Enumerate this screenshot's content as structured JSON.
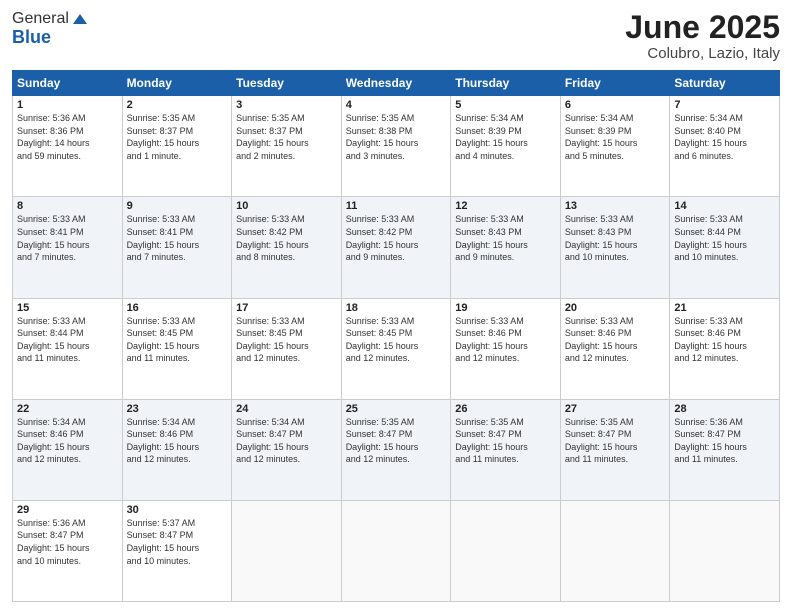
{
  "header": {
    "logo_general": "General",
    "logo_blue": "Blue",
    "month_title": "June 2025",
    "location": "Colubro, Lazio, Italy"
  },
  "weekdays": [
    "Sunday",
    "Monday",
    "Tuesday",
    "Wednesday",
    "Thursday",
    "Friday",
    "Saturday"
  ],
  "weeks": [
    [
      {
        "day": 1,
        "info": "Sunrise: 5:36 AM\nSunset: 8:36 PM\nDaylight: 14 hours\nand 59 minutes."
      },
      {
        "day": 2,
        "info": "Sunrise: 5:35 AM\nSunset: 8:37 PM\nDaylight: 15 hours\nand 1 minute."
      },
      {
        "day": 3,
        "info": "Sunrise: 5:35 AM\nSunset: 8:37 PM\nDaylight: 15 hours\nand 2 minutes."
      },
      {
        "day": 4,
        "info": "Sunrise: 5:35 AM\nSunset: 8:38 PM\nDaylight: 15 hours\nand 3 minutes."
      },
      {
        "day": 5,
        "info": "Sunrise: 5:34 AM\nSunset: 8:39 PM\nDaylight: 15 hours\nand 4 minutes."
      },
      {
        "day": 6,
        "info": "Sunrise: 5:34 AM\nSunset: 8:39 PM\nDaylight: 15 hours\nand 5 minutes."
      },
      {
        "day": 7,
        "info": "Sunrise: 5:34 AM\nSunset: 8:40 PM\nDaylight: 15 hours\nand 6 minutes."
      }
    ],
    [
      {
        "day": 8,
        "info": "Sunrise: 5:33 AM\nSunset: 8:41 PM\nDaylight: 15 hours\nand 7 minutes."
      },
      {
        "day": 9,
        "info": "Sunrise: 5:33 AM\nSunset: 8:41 PM\nDaylight: 15 hours\nand 7 minutes."
      },
      {
        "day": 10,
        "info": "Sunrise: 5:33 AM\nSunset: 8:42 PM\nDaylight: 15 hours\nand 8 minutes."
      },
      {
        "day": 11,
        "info": "Sunrise: 5:33 AM\nSunset: 8:42 PM\nDaylight: 15 hours\nand 9 minutes."
      },
      {
        "day": 12,
        "info": "Sunrise: 5:33 AM\nSunset: 8:43 PM\nDaylight: 15 hours\nand 9 minutes."
      },
      {
        "day": 13,
        "info": "Sunrise: 5:33 AM\nSunset: 8:43 PM\nDaylight: 15 hours\nand 10 minutes."
      },
      {
        "day": 14,
        "info": "Sunrise: 5:33 AM\nSunset: 8:44 PM\nDaylight: 15 hours\nand 10 minutes."
      }
    ],
    [
      {
        "day": 15,
        "info": "Sunrise: 5:33 AM\nSunset: 8:44 PM\nDaylight: 15 hours\nand 11 minutes."
      },
      {
        "day": 16,
        "info": "Sunrise: 5:33 AM\nSunset: 8:45 PM\nDaylight: 15 hours\nand 11 minutes."
      },
      {
        "day": 17,
        "info": "Sunrise: 5:33 AM\nSunset: 8:45 PM\nDaylight: 15 hours\nand 12 minutes."
      },
      {
        "day": 18,
        "info": "Sunrise: 5:33 AM\nSunset: 8:45 PM\nDaylight: 15 hours\nand 12 minutes."
      },
      {
        "day": 19,
        "info": "Sunrise: 5:33 AM\nSunset: 8:46 PM\nDaylight: 15 hours\nand 12 minutes."
      },
      {
        "day": 20,
        "info": "Sunrise: 5:33 AM\nSunset: 8:46 PM\nDaylight: 15 hours\nand 12 minutes."
      },
      {
        "day": 21,
        "info": "Sunrise: 5:33 AM\nSunset: 8:46 PM\nDaylight: 15 hours\nand 12 minutes."
      }
    ],
    [
      {
        "day": 22,
        "info": "Sunrise: 5:34 AM\nSunset: 8:46 PM\nDaylight: 15 hours\nand 12 minutes."
      },
      {
        "day": 23,
        "info": "Sunrise: 5:34 AM\nSunset: 8:46 PM\nDaylight: 15 hours\nand 12 minutes."
      },
      {
        "day": 24,
        "info": "Sunrise: 5:34 AM\nSunset: 8:47 PM\nDaylight: 15 hours\nand 12 minutes."
      },
      {
        "day": 25,
        "info": "Sunrise: 5:35 AM\nSunset: 8:47 PM\nDaylight: 15 hours\nand 12 minutes."
      },
      {
        "day": 26,
        "info": "Sunrise: 5:35 AM\nSunset: 8:47 PM\nDaylight: 15 hours\nand 11 minutes."
      },
      {
        "day": 27,
        "info": "Sunrise: 5:35 AM\nSunset: 8:47 PM\nDaylight: 15 hours\nand 11 minutes."
      },
      {
        "day": 28,
        "info": "Sunrise: 5:36 AM\nSunset: 8:47 PM\nDaylight: 15 hours\nand 11 minutes."
      }
    ],
    [
      {
        "day": 29,
        "info": "Sunrise: 5:36 AM\nSunset: 8:47 PM\nDaylight: 15 hours\nand 10 minutes."
      },
      {
        "day": 30,
        "info": "Sunrise: 5:37 AM\nSunset: 8:47 PM\nDaylight: 15 hours\nand 10 minutes."
      },
      null,
      null,
      null,
      null,
      null
    ]
  ]
}
